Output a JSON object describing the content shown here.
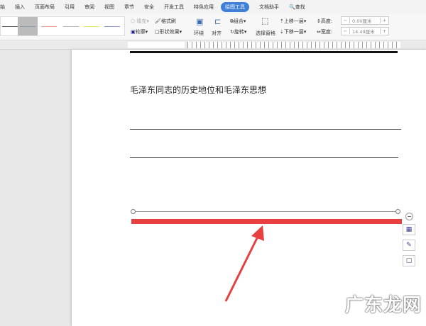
{
  "tabs": [
    "始",
    "插入",
    "页面布局",
    "引用",
    "审阅",
    "视图",
    "章节",
    "安全",
    "开发工具",
    "特色应用",
    "绘图工具",
    "文档助手"
  ],
  "active_tab": "绘图工具",
  "search_label": "查找",
  "ribbon": {
    "fill": "填充",
    "format_painter": "格式刷",
    "outline": "轮廓",
    "shape_effects": "形状效果",
    "wrap": "环绕",
    "align": "对齐",
    "group": "组合",
    "rotate": "旋转",
    "select_pane": "选择窗格",
    "bring_forward": "上移一层",
    "send_backward": "下移一层",
    "height_label": "高度:",
    "height_value": "0.00厘米",
    "width_label": "宽度:",
    "width_value": "14.49厘米",
    "minus": "−",
    "plus": "+"
  },
  "line_style_colors": [
    "#555555",
    "#8a9ab0",
    "#e8a090",
    "#bbbbbb",
    "#e8e070",
    "#8a9ac8"
  ],
  "document": {
    "heading": "毛泽东同志的历史地位和毛泽东思想"
  },
  "highlight_color": "#e84040",
  "watermark": "广东龙网"
}
